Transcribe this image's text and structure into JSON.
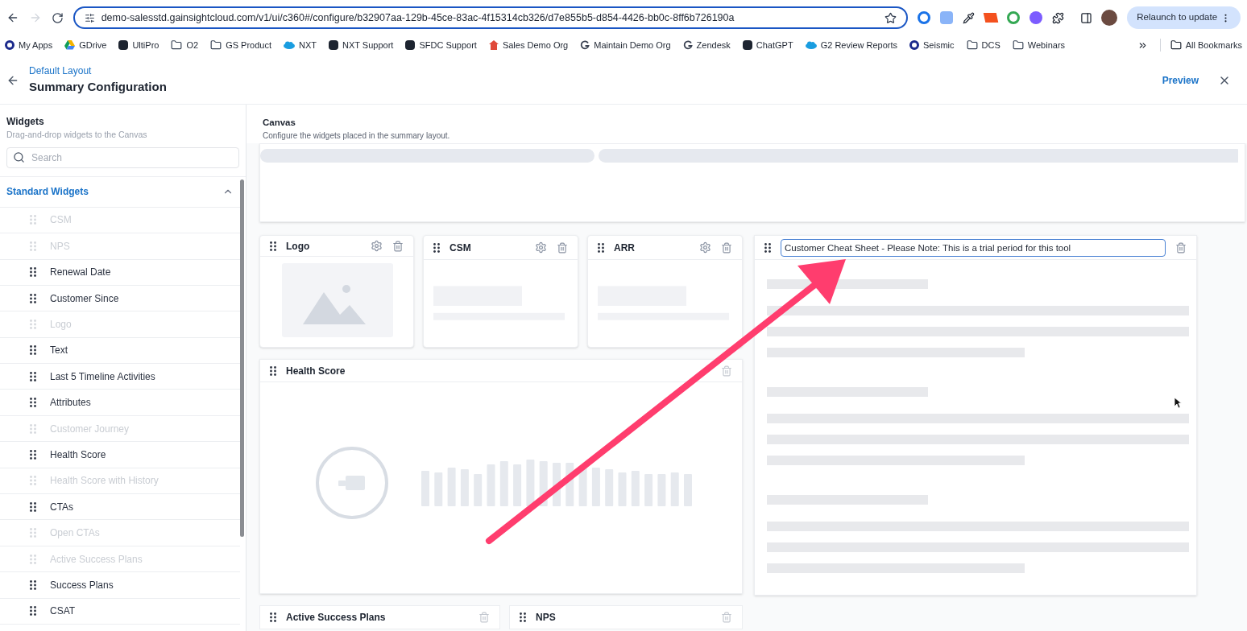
{
  "browser": {
    "url": "demo-salesstd.gainsightcloud.com/v1/ui/c360#/configure/b32907aa-129b-45ce-83ac-4f15314cb326/d7e855b5-d854-4426-bb0c-8ff6b726190a",
    "update_button": "Relaunch to update",
    "bookmarks": [
      {
        "label": "My Apps",
        "kind": "ring"
      },
      {
        "label": "GDrive",
        "kind": "drive"
      },
      {
        "label": "UltiPro",
        "kind": "square"
      },
      {
        "label": "O2",
        "kind": "folder"
      },
      {
        "label": "GS Product",
        "kind": "folder"
      },
      {
        "label": "NXT",
        "kind": "cloud"
      },
      {
        "label": "NXT Support",
        "kind": "square"
      },
      {
        "label": "SFDC Support",
        "kind": "square"
      },
      {
        "label": "Sales Demo Org",
        "kind": "house"
      },
      {
        "label": "Maintain Demo Org",
        "kind": "letter"
      },
      {
        "label": "Zendesk",
        "kind": "letter"
      },
      {
        "label": "ChatGPT",
        "kind": "square"
      },
      {
        "label": "G2 Review Reports",
        "kind": "cloud"
      },
      {
        "label": "Seismic",
        "kind": "ring"
      },
      {
        "label": "DCS",
        "kind": "folder"
      },
      {
        "label": "Webinars",
        "kind": "folder"
      }
    ],
    "all_bookmarks": "All Bookmarks"
  },
  "header": {
    "breadcrumb": "Default Layout",
    "title": "Summary Configuration",
    "preview": "Preview"
  },
  "sidebar": {
    "title": "Widgets",
    "subtitle": "Drag-and-drop widgets to the Canvas",
    "search": {
      "placeholder": "Search"
    },
    "section": {
      "title": "Standard Widgets",
      "expanded": true
    },
    "items": [
      {
        "label": "CSM",
        "disabled": true
      },
      {
        "label": "NPS",
        "disabled": true
      },
      {
        "label": "Renewal Date",
        "disabled": false
      },
      {
        "label": "Customer Since",
        "disabled": false
      },
      {
        "label": "Logo",
        "disabled": true
      },
      {
        "label": "Text",
        "disabled": false
      },
      {
        "label": "Last 5 Timeline Activities",
        "disabled": false
      },
      {
        "label": "Attributes",
        "disabled": false
      },
      {
        "label": "Customer Journey",
        "disabled": true
      },
      {
        "label": "Health Score",
        "disabled": false
      },
      {
        "label": "Health Score with History",
        "disabled": true
      },
      {
        "label": "CTAs",
        "disabled": false
      },
      {
        "label": "Open CTAs",
        "disabled": true
      },
      {
        "label": "Active Success Plans",
        "disabled": true
      },
      {
        "label": "Success Plans",
        "disabled": false
      },
      {
        "label": "CSAT",
        "disabled": false
      }
    ]
  },
  "canvas": {
    "title": "Canvas",
    "subtitle": "Configure the widgets placed in the summary layout.",
    "small_widgets": [
      {
        "title": "Logo",
        "kind": "logo"
      },
      {
        "title": "CSM",
        "kind": "metric"
      },
      {
        "title": "ARR",
        "kind": "metric"
      }
    ],
    "health_widget": {
      "title": "Health Score"
    },
    "text_widget": {
      "value": "Customer Cheat Sheet - Please Note: This is a trial period for this tool"
    },
    "bottom_widgets": [
      {
        "title": "Active Success Plans"
      },
      {
        "title": "NPS"
      }
    ]
  }
}
